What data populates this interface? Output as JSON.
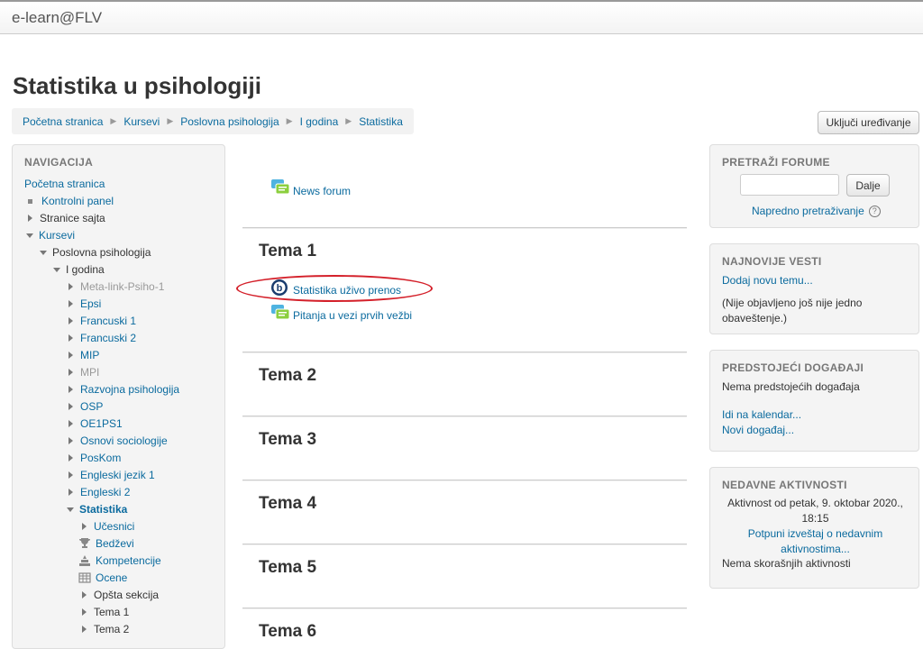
{
  "header": {
    "brand": "e-learn@FLV"
  },
  "page": {
    "title": "Statistika u psihologiji"
  },
  "breadcrumb": [
    "Početna stranica",
    "Kursevi",
    "Poslovna psihologija",
    "I godina",
    "Statistika"
  ],
  "edit_button": "Uključi uređivanje",
  "navigation": {
    "title": "NAVIGACIJA",
    "items": [
      "Početna stranica",
      "Kontrolni panel",
      "Stranice sajta",
      "Kursevi",
      "Poslovna psihologija",
      "I godina",
      "Meta-link-Psiho-1",
      "Epsi",
      "Francuski 1",
      "Francuski 2",
      "MIP",
      "MPI",
      "Razvojna psihologija",
      "OSP",
      "OE1PS1",
      "Osnovi sociologije",
      "PosKom",
      "Engleski jezik 1",
      "Engleski 2",
      "Statistika",
      "Učesnici",
      "Bedževi",
      "Kompetencije",
      "Ocene",
      "Opšta sekcija",
      "Tema 1",
      "Tema 2"
    ]
  },
  "content": {
    "news_forum": "News forum",
    "topics": [
      {
        "title": "Tema 1",
        "activities": [
          "Statistika uživo prenos",
          "Pitanja u vezi prvih vežbi"
        ]
      },
      {
        "title": "Tema 2"
      },
      {
        "title": "Tema 3"
      },
      {
        "title": "Tema 4"
      },
      {
        "title": "Tema 5"
      },
      {
        "title": "Tema 6"
      }
    ]
  },
  "blocks": {
    "search_forums": {
      "title": "PRETRAŽI FORUME",
      "button": "Dalje",
      "advanced_link": "Napredno pretraživanje"
    },
    "latest_news": {
      "title": "NAJNOVIJE VESTI",
      "add_link": "Dodaj novu temu...",
      "empty_line1": "(Nije objavljeno još nije jedno",
      "empty_line2": "obaveštenje.)"
    },
    "upcoming_events": {
      "title": "PREDSTOJEĆI DOGAĐAJI",
      "empty": "Nema predstojećih događaja",
      "calendar_link": "Idi na kalendar...",
      "new_event_link": "Novi događaj..."
    },
    "recent_activity": {
      "title": "NEDAVNE AKTIVNOSTI",
      "since_line1": "Aktivnost od petak, 9. oktobar 2020.,",
      "since_line2": "18:15",
      "report_line1": "Potpuni izveštaj o nedavnim",
      "report_line2": "aktivnostima...",
      "empty": "Nema skorašnjih aktivnosti"
    }
  },
  "colors": {
    "link": "#0a6a9e",
    "highlight_oval": "#d4202a"
  }
}
